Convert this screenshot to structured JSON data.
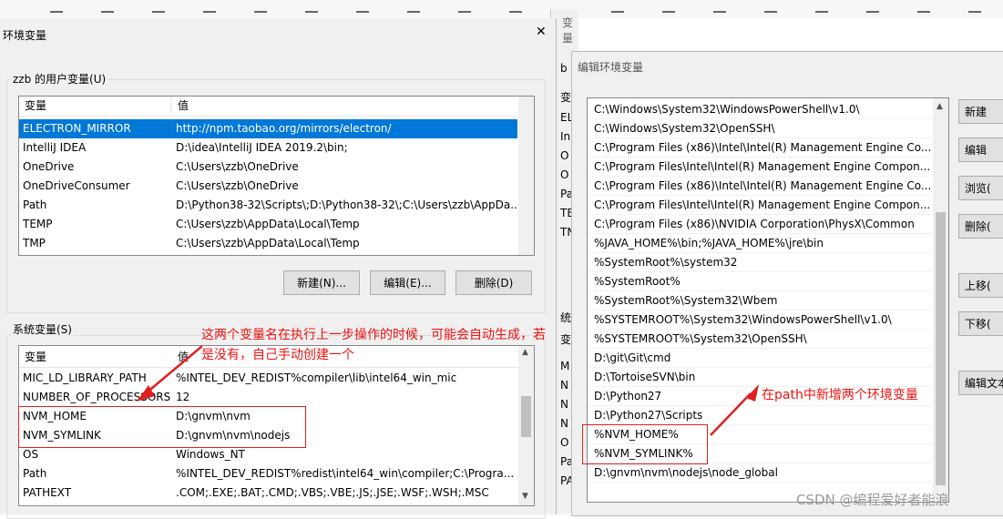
{
  "toolbar_icons": [
    "table-icon",
    "link-icon",
    "image-icon",
    "list-icon",
    "list-ordered-icon",
    "download-icon",
    "upload-icon",
    "code-icon",
    "chart-icon",
    "undo-icon",
    "redo-icon",
    "table-icon",
    "pen-icon",
    "image-icon",
    "list-icon",
    "download-icon",
    "upload-icon",
    "code-icon",
    "undo-icon"
  ],
  "env_dialog": {
    "title": "环境变量",
    "close_label": "✕",
    "user_group_title": "zzb 的用户变量(U)",
    "user_headers": {
      "name": "变量",
      "value": "值"
    },
    "user_vars": [
      {
        "name": "ELECTRON_MIRROR",
        "value": "http://npm.taobao.org/mirrors/electron/"
      },
      {
        "name": "IntelliJ IDEA",
        "value": "D:\\idea\\IntelliJ IDEA 2019.2\\bin;"
      },
      {
        "name": "OneDrive",
        "value": "C:\\Users\\zzb\\OneDrive"
      },
      {
        "name": "OneDriveConsumer",
        "value": "C:\\Users\\zzb\\OneDrive"
      },
      {
        "name": "Path",
        "value": "D:\\Python38-32\\Scripts\\;D:\\Python38-32\\;C:\\Users\\zzb\\AppDa..."
      },
      {
        "name": "TEMP",
        "value": "C:\\Users\\zzb\\AppData\\Local\\Temp"
      },
      {
        "name": "TMP",
        "value": "C:\\Users\\zzb\\AppData\\Local\\Temp"
      }
    ],
    "user_buttons": {
      "new": "新建(N)...",
      "edit": "编辑(E)...",
      "delete": "删除(D)"
    },
    "system_group_title": "系统变量(S)",
    "system_headers": {
      "name": "变量",
      "value": "值"
    },
    "system_vars": [
      {
        "name": "MIC_LD_LIBRARY_PATH",
        "value": "%INTEL_DEV_REDIST%compiler\\lib\\intel64_win_mic"
      },
      {
        "name": "NUMBER_OF_PROCESSORS",
        "value": "12"
      },
      {
        "name": "NVM_HOME",
        "value": "D:\\gnvm\\nvm"
      },
      {
        "name": "NVM_SYMLINK",
        "value": "D:\\gnvm\\nvm\\nodejs"
      },
      {
        "name": "OS",
        "value": "Windows_NT"
      },
      {
        "name": "Path",
        "value": "%INTEL_DEV_REDIST%redist\\intel64_win\\compiler;C:\\Progra..."
      },
      {
        "name": "PATHEXT",
        "value": ".COM;.EXE;.BAT;.CMD;.VBS;.VBE;.JS;.JSE;.WSF;.WSH;.MSC"
      }
    ],
    "annotation": "这两个变量名在执行上一步操作的时候，可能会自动生成，若是没有，自己手动创建一个"
  },
  "bg_dialog": {
    "title_partial": "变量",
    "left_fragments": [
      "b",
      "变",
      "EL",
      "In",
      "O",
      "O",
      "Pa",
      "TE",
      "TN",
      "统",
      "变",
      "M",
      "N",
      "N",
      "N",
      "O",
      "Pa",
      "PA"
    ]
  },
  "edit_dialog": {
    "title": "编辑环境变量",
    "items": [
      "C:\\Windows\\System32\\WindowsPowerShell\\v1.0\\",
      "C:\\Windows\\System32\\OpenSSH\\",
      "C:\\Program Files (x86)\\Intel\\Intel(R) Management Engine Co...",
      "C:\\Program Files\\Intel\\Intel(R) Management Engine Compon...",
      "C:\\Program Files (x86)\\Intel\\Intel(R) Management Engine Co...",
      "C:\\Program Files\\Intel\\Intel(R) Management Engine Compon...",
      "C:\\Program Files (x86)\\NVIDIA Corporation\\PhysX\\Common",
      "%JAVA_HOME%\\bin;%JAVA_HOME%\\jre\\bin",
      "%SystemRoot%\\system32",
      "%SystemRoot%",
      "%SystemRoot%\\System32\\Wbem",
      "%SYSTEMROOT%\\System32\\WindowsPowerShell\\v1.0\\",
      "%SYSTEMROOT%\\System32\\OpenSSH\\",
      "D:\\git\\Git\\cmd",
      "D:\\TortoiseSVN\\bin",
      "D:\\Python27",
      "D:\\Python27\\Scripts",
      "%NVM_HOME%",
      "%NVM_SYMLINK%",
      "D:\\gnvm\\nvm\\nodejs\\node_global"
    ],
    "buttons": [
      "新建",
      "编辑",
      "浏览(",
      "删除(",
      "上移(",
      "下移(",
      "编辑文本"
    ],
    "annotation": "在path中新增两个环境变量"
  },
  "watermark": "CSDN @编程爱好者能浪"
}
